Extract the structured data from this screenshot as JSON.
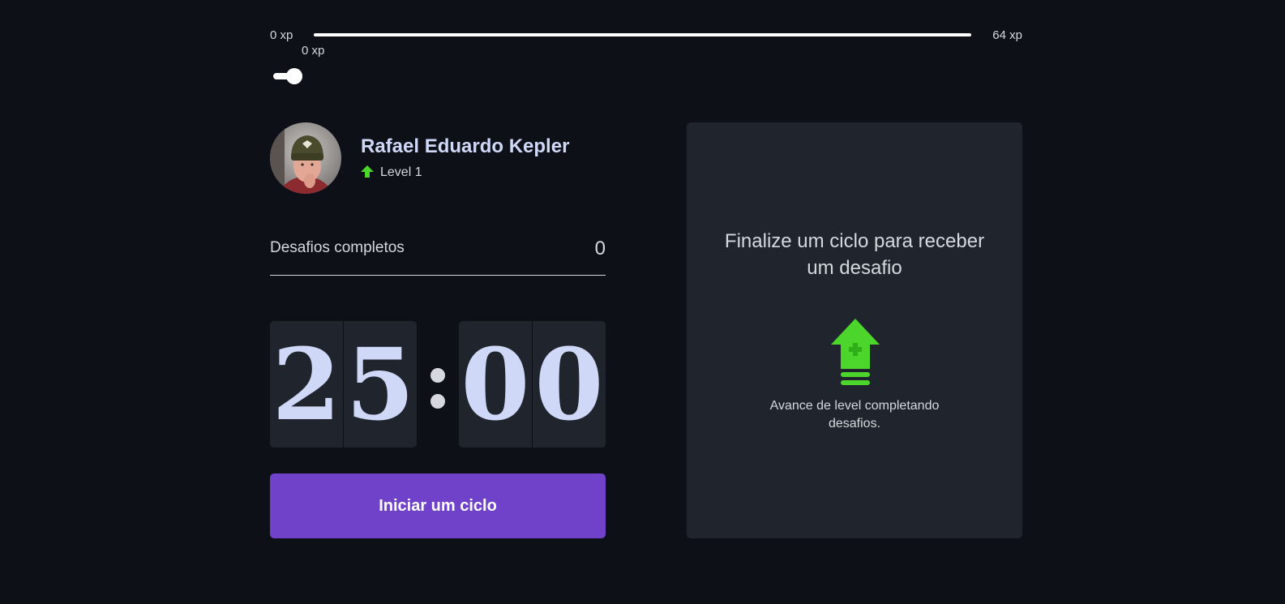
{
  "xp": {
    "min_label": "0 xp",
    "max_label": "64 xp",
    "current_label": "0 xp",
    "progress": 0.0
  },
  "theme_toggle": {
    "state": "on"
  },
  "profile": {
    "name": "Rafael Eduardo Kepler",
    "level_label": "Level 1"
  },
  "completed_challenges": {
    "label": "Desafios completos",
    "value": "0"
  },
  "countdown": {
    "minute_left": "2",
    "minute_right": "5",
    "second_left": "0",
    "second_right": "0"
  },
  "start_button": {
    "label": "Iniciar um ciclo"
  },
  "challenge": {
    "title": "Finalize um ciclo para receber um desafio",
    "hint": "Avance de level completando desafios."
  },
  "colors": {
    "background": "#0d1017",
    "panel": "#20242d",
    "accent_purple": "#6f42c9",
    "accent_green": "#4cd62b",
    "title_blue": "#cfd8f6"
  },
  "icons": {
    "level": "level-up-arrow-icon",
    "challenge": "level-up-arrow-icon"
  }
}
